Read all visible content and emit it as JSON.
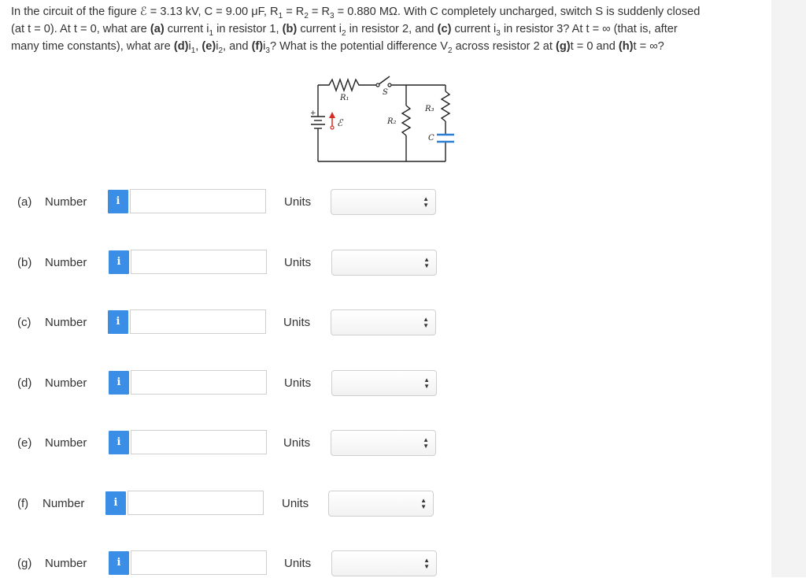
{
  "question": {
    "line1_part1": "In the circuit of the figure ℰ = 3.13 kV, C = 9.00 μF, R",
    "line1_sub1": "1",
    "line1_part2": " = R",
    "line1_sub2": "2",
    "line1_part3": " = R",
    "line1_sub3": "3",
    "line1_part4": " = 0.880 MΩ. With C completely uncharged, switch S is suddenly closed",
    "line2_part1": "(at t = 0). At t = 0, what are ",
    "line2_a": "(a)",
    "line2_part2": " current i",
    "line2_sub1": "1",
    "line2_part3": " in resistor 1, ",
    "line2_b": "(b)",
    "line2_part4": " current i",
    "line2_sub2": "2",
    "line2_part5": " in resistor 2, and ",
    "line2_c": "(c)",
    "line2_part6": " current i",
    "line2_sub3": "3",
    "line2_part7": " in resistor 3? At t = ∞ (that is, after",
    "line3_part1": "many time constants), what are ",
    "line3_d": "(d)",
    "line3_part2": "i",
    "line3_sub1": "1",
    "line3_part3": ", ",
    "line3_e": "(e)",
    "line3_part4": "i",
    "line3_sub2": "2",
    "line3_part5": ", and ",
    "line3_f": "(f)",
    "line3_part6": "i",
    "line3_sub3": "3",
    "line3_part7": "? What is the potential difference V",
    "line3_sub4": "2",
    "line3_part8": " across resistor 2 at ",
    "line3_g": "(g)",
    "line3_part9": "t = 0 and ",
    "line3_h": "(h)",
    "line3_part10": "t = ∞?"
  },
  "figure": {
    "r1": "R₁",
    "r2": "R₂",
    "r3": "R₃",
    "s": "S",
    "c": "C",
    "emf": "ℰ",
    "plus": "+"
  },
  "rows": [
    {
      "letter": "(a)",
      "label": "Number",
      "info": "i",
      "value": "",
      "units_label": "Units",
      "units_value": ""
    },
    {
      "letter": "(b)",
      "label": "Number",
      "info": "i",
      "value": "",
      "units_label": "Units",
      "units_value": ""
    },
    {
      "letter": "(c)",
      "label": "Number",
      "info": "i",
      "value": "",
      "units_label": "Units",
      "units_value": ""
    },
    {
      "letter": "(d)",
      "label": "Number",
      "info": "i",
      "value": "",
      "units_label": "Units",
      "units_value": ""
    },
    {
      "letter": "(e)",
      "label": "Number",
      "info": "i",
      "value": "",
      "units_label": "Units",
      "units_value": ""
    },
    {
      "letter": "(f)",
      "label": "Number",
      "info": "i",
      "value": "",
      "units_label": "Units",
      "units_value": ""
    },
    {
      "letter": "(g)",
      "label": "Number",
      "info": "i",
      "value": "",
      "units_label": "Units",
      "units_value": ""
    }
  ],
  "colors": {
    "info_button": "#3a8ee6",
    "input_border": "#cfcfcf",
    "emf_arrow": "#d62d20",
    "capacitor": "#2a7fd4"
  }
}
